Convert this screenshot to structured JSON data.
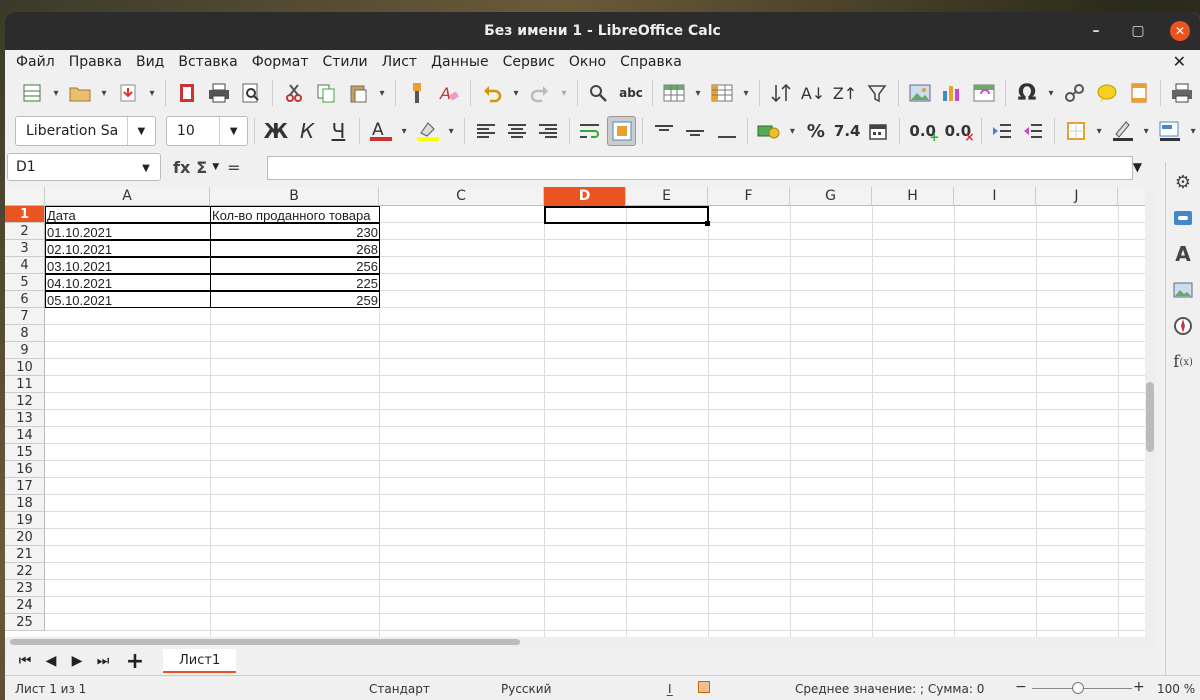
{
  "window": {
    "title": "Без имени 1 - LibreOffice Calc",
    "min_label": "–",
    "max_label": "▢",
    "close_label": "✕",
    "doc_close_label": "✕"
  },
  "menu": [
    "Файл",
    "Правка",
    "Вид",
    "Вставка",
    "Формат",
    "Стили",
    "Лист",
    "Данные",
    "Сервис",
    "Окно",
    "Справка"
  ],
  "formatting": {
    "font_name": "Liberation Sa",
    "font_size": "10",
    "bold_label": "Ж",
    "italic_label": "К",
    "underline_label": "Ч",
    "percent_label": "%",
    "number_label": "7.4",
    "add_decimal_label": "0.0",
    "del_decimal_label": "0.0"
  },
  "formula_bar": {
    "cell_ref": "D1",
    "fx_label": "fx",
    "sum_label": "Σ",
    "eq_label": "=",
    "content": ""
  },
  "columns": [
    "A",
    "B",
    "C",
    "D",
    "E",
    "F",
    "G",
    "H",
    "I",
    "J"
  ],
  "active_column": "D",
  "active_row": "1",
  "rows": [
    "1",
    "2",
    "3",
    "4",
    "5",
    "6",
    "7",
    "8",
    "9",
    "10",
    "11",
    "12",
    "13",
    "14",
    "15",
    "16",
    "17",
    "18",
    "19",
    "20",
    "21",
    "22",
    "23",
    "24",
    "25"
  ],
  "cells": {
    "A1": "Дата",
    "B1": "Кол-во проданного товара",
    "A2": "01.10.2021",
    "B2": "230",
    "A3": "02.10.2021",
    "B3": "268",
    "A4": "03.10.2021",
    "B4": "256",
    "A5": "04.10.2021",
    "B5": "225",
    "A6": "05.10.2021",
    "B6": "259"
  },
  "sheet": {
    "add_label": "+",
    "tab_name": "Лист1"
  },
  "status": {
    "sheet_info": "Лист 1 из 1",
    "style": "Стандарт",
    "language": "Русский",
    "summary": "Среднее значение: ; Сумма: 0",
    "zoom_minus": "−",
    "zoom_plus": "+",
    "zoom": "100 %"
  },
  "colors": {
    "accent": "#e95420",
    "titlebar": "#2c2c2c"
  }
}
